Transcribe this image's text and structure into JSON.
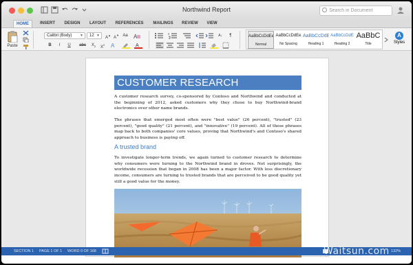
{
  "window": {
    "title": "Northwind Report"
  },
  "search": {
    "placeholder": "Search in Document"
  },
  "tabs": [
    "HOME",
    "INSERT",
    "DESIGN",
    "LAYOUT",
    "REFERENCES",
    "MAILINGS",
    "REVIEW",
    "VIEW"
  ],
  "active_tab": "HOME",
  "ribbon": {
    "paste_label": "Paste",
    "font_name": "Calibri (Body)",
    "font_size": "12",
    "styles_pane_label": "Styles",
    "styles": [
      {
        "preview": "AaBbCcDdEe",
        "name": "Normal",
        "selected": true
      },
      {
        "preview": "AaBbCcDdEe",
        "name": "No Spacing"
      },
      {
        "preview": "AaBbCcDdE",
        "name": "Heading 1"
      },
      {
        "preview": "AaBbCcDdE",
        "name": "Heading 2"
      },
      {
        "preview": "AaBbC",
        "name": "Title"
      }
    ]
  },
  "document": {
    "heading": "CUSTOMER RESEARCH",
    "para1": "A customer research survey, co-sponsored by Contoso and Northwind and conducted at the beginning of 2012, asked customers why they chose to buy Northwind-brand electronics over other name brands.",
    "para2": "The phrases that emerged most often were \"best value\" (26 percent), \"trusted\" (23 percent), \"good quality\" (21 percent), and \"innovative\" (19 percent). All of these phrases map back to both companies' core values, proving that Northwind's and Contoso's shared approach to business is paying off.",
    "subheading": "A trusted brand",
    "para3": "To investigate longer-term trends, we again turned to customer research to determine why consumers were turning to the Northwind brand in droves. Not surprisingly, the worldwide recession that began in 2008 has been a major factor. With less discretionary income, consumers are turning to trusted brands that are perceived to be good quality yet still a good value for the money."
  },
  "status": {
    "section": "SECTION 1",
    "page": "PAGE 1 OF 1",
    "words": "WORD 0 OF 168",
    "zoom": "132%"
  },
  "watermark": "Waitsun.com",
  "colors": {
    "accent": "#2b63b0",
    "heading_fill": "#4a7fc1",
    "subheading": "#3e7cc4"
  }
}
